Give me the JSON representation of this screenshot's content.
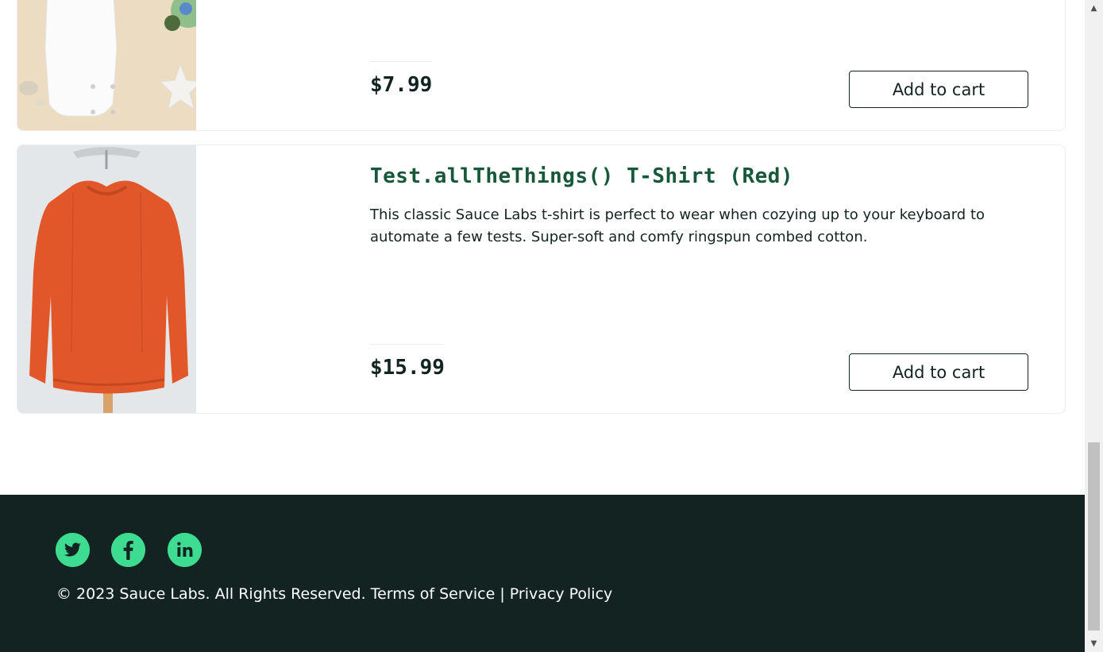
{
  "inventory": {
    "items": [
      {
        "title": "",
        "description": "",
        "price": "$7.99",
        "button_label": "Add to cart",
        "image_icon": "onesie-photo"
      },
      {
        "title": "Test.allTheThings() T-Shirt (Red)",
        "description": "This classic Sauce Labs t-shirt is perfect to wear when cozying up to your keyboard to automate a few tests. Super-soft and comfy ringspun combed cotton.",
        "price": "$15.99",
        "button_label": "Add to cart",
        "image_icon": "red-sweatshirt-photo"
      }
    ]
  },
  "footer": {
    "social": [
      "twitter-icon",
      "facebook-icon",
      "linkedin-icon"
    ],
    "copyright": "© 2023 Sauce Labs. All Rights Reserved.",
    "terms_label": "Terms of Service",
    "separator": "|",
    "privacy_label": "Privacy Policy"
  },
  "colors": {
    "footer_bg": "#132322",
    "social_green": "#3ddc91",
    "title_green": "#18583a",
    "text_dark": "#132322"
  }
}
